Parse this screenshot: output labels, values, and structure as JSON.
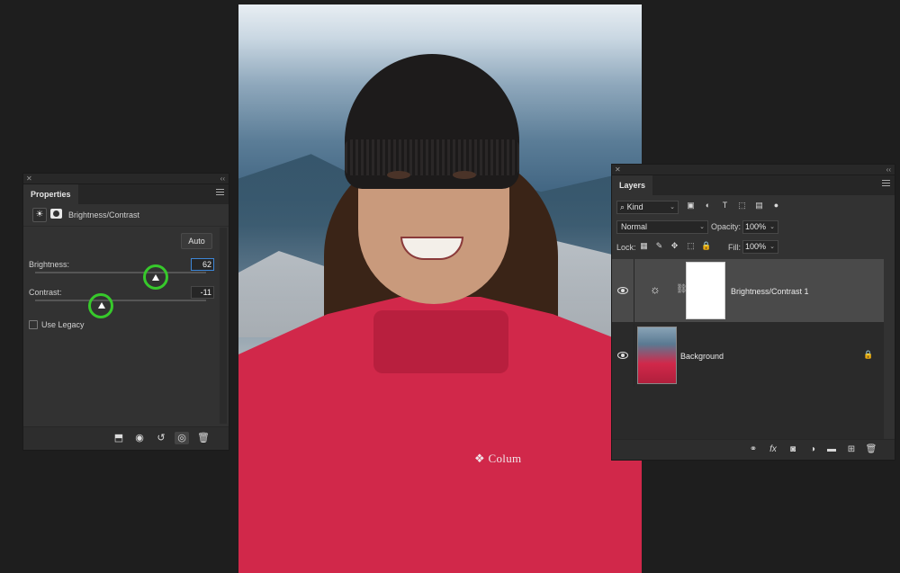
{
  "properties_panel": {
    "close_glyph": "✕",
    "collapse_glyph": "‹‹",
    "tab_label": "Properties",
    "adjustment_title": "Brightness/Contrast",
    "auto_label": "Auto",
    "brightness": {
      "label": "Brightness:",
      "value": "62",
      "slider_position": 0.75
    },
    "contrast": {
      "label": "Contrast:",
      "value": "-11",
      "slider_position": 0.4
    },
    "use_legacy_label": "Use Legacy",
    "use_legacy_checked": false,
    "footer_icons": [
      "clip-to-layer-icon",
      "view-previous-state-icon",
      "reset-icon",
      "visibility-icon",
      "delete-icon"
    ]
  },
  "layers_panel": {
    "close_glyph": "✕",
    "collapse_glyph": "‹‹",
    "tab_label": "Layers",
    "filter_kind": "Kind",
    "blend_mode": "Normal",
    "opacity_label": "Opacity:",
    "opacity_value": "100%",
    "lock_label": "Lock:",
    "fill_label": "Fill:",
    "fill_value": "100%",
    "layers": [
      {
        "name": "Brightness/Contrast 1",
        "visible": true,
        "selected": true,
        "type": "adjustment"
      },
      {
        "name": "Background",
        "visible": true,
        "selected": false,
        "type": "image",
        "locked": true
      }
    ],
    "footer_icons": [
      "link-icon",
      "fx-icon",
      "add-mask-icon",
      "new-adjustment-icon",
      "new-group-icon",
      "new-layer-icon",
      "delete-icon"
    ]
  },
  "canvas": {
    "jacket_logo_text": "Colum",
    "colors": {
      "jacket": "#d1284a",
      "beanie": "#1d1b1b",
      "hair": "#3a2417"
    }
  },
  "theme": {
    "highlight_ring": "#37c92b",
    "panel_bg": "#323232",
    "app_bg": "#1e1e1e"
  }
}
